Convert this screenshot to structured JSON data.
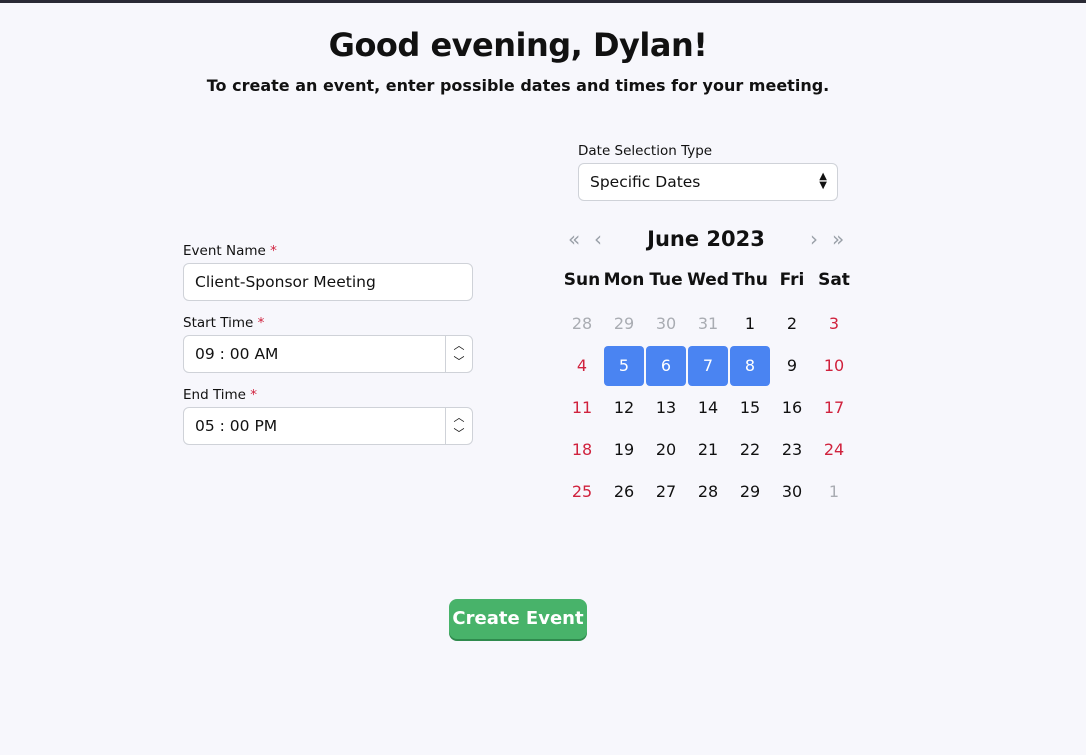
{
  "header": {
    "greeting": "Good evening, Dylan!",
    "subtitle": "To create an event, enter possible dates and times for your meeting."
  },
  "form": {
    "event_name_label": "Event Name",
    "event_name_value": "Client-Sponsor Meeting",
    "start_time_label": "Start Time",
    "start_time_value": "09 : 00 AM",
    "end_time_label": "End Time",
    "end_time_value": "05 : 00 PM",
    "required_mark": "*"
  },
  "date_selection": {
    "label": "Date Selection Type",
    "value": "Specific Dates"
  },
  "calendar": {
    "month_title": "June 2023",
    "nav": {
      "prev_year": "«",
      "prev_month": "‹",
      "next_month": "›",
      "next_year": "»"
    },
    "weekdays": [
      "Sun",
      "Mon",
      "Tue",
      "Wed",
      "Thu",
      "Fri",
      "Sat"
    ],
    "weeks": [
      [
        "28",
        "29",
        "30",
        "31",
        "1",
        "2",
        "3"
      ],
      [
        "4",
        "5",
        "6",
        "7",
        "8",
        "9",
        "10"
      ],
      [
        "11",
        "12",
        "13",
        "14",
        "15",
        "16",
        "17"
      ],
      [
        "18",
        "19",
        "20",
        "21",
        "22",
        "23",
        "24"
      ],
      [
        "25",
        "26",
        "27",
        "28",
        "29",
        "30",
        "1"
      ]
    ],
    "selected_dates": [
      "5",
      "6",
      "7",
      "8"
    ],
    "colors": {
      "selected": "#4a84f2",
      "weekend": "#d0223d",
      "other_month": "#a9acb2"
    }
  },
  "actions": {
    "create_label": "Create Event",
    "create_color": "#48b36a"
  }
}
